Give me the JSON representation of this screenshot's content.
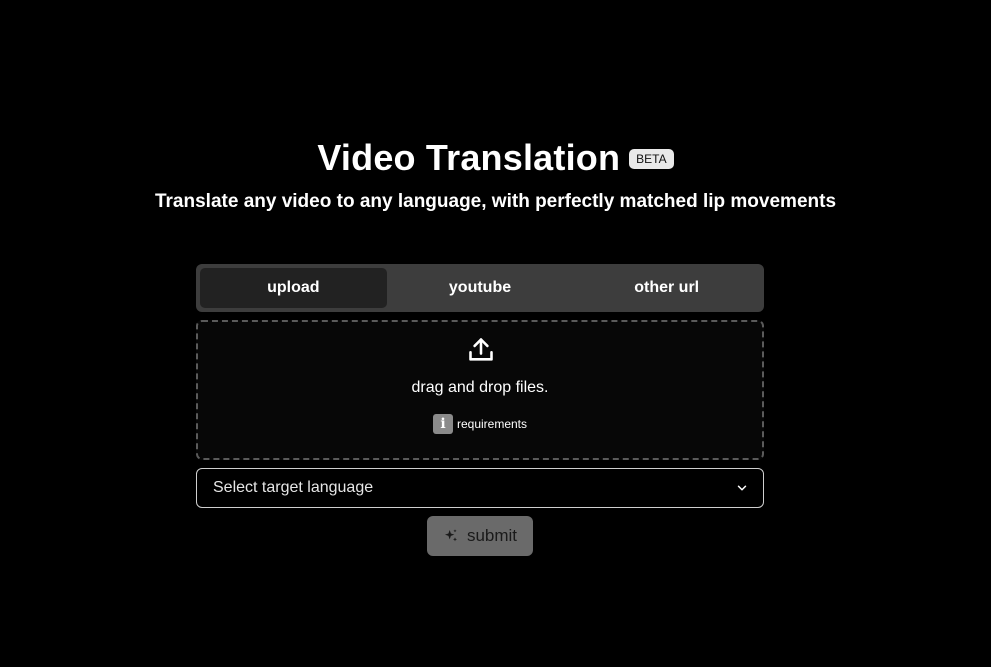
{
  "header": {
    "title": "Video Translation",
    "badge": "BETA",
    "subtitle": "Translate any video to any language, with perfectly matched lip movements"
  },
  "tabs": [
    {
      "label": "upload",
      "active": true
    },
    {
      "label": "youtube",
      "active": false
    },
    {
      "label": "other url",
      "active": false
    }
  ],
  "dropzone": {
    "icon": "upload-icon",
    "text": "drag and drop files.",
    "requirements_icon": "info-icon",
    "requirements_label": "requirements"
  },
  "language_select": {
    "value": "Select target language",
    "icon": "chevron-down-icon"
  },
  "submit": {
    "label": "submit",
    "icon": "sparkle-icon"
  }
}
